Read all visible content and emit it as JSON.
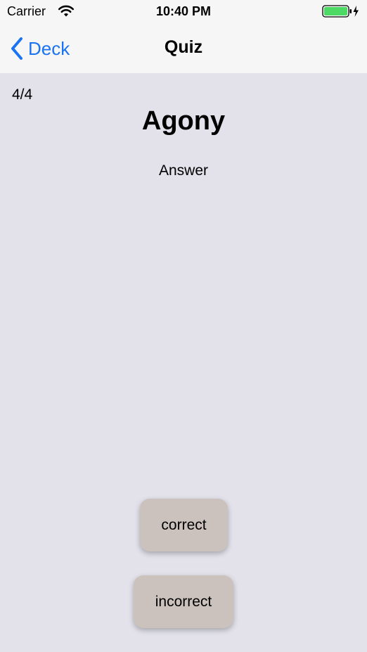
{
  "status_bar": {
    "carrier": "Carrier",
    "time": "10:40 PM",
    "battery_color": "#4cd964",
    "icons": [
      "wifi-icon",
      "battery-icon",
      "charging-bolt-icon"
    ]
  },
  "nav": {
    "back_label": "Deck",
    "title": "Quiz",
    "accent_color": "#1a73f0"
  },
  "quiz": {
    "progress": "4/4",
    "question": "Agony",
    "answer_toggle": "Answer",
    "correct_label": "correct",
    "incorrect_label": "incorrect"
  },
  "colors": {
    "background": "#e3e2eb",
    "bar_background": "#f6f6f6",
    "button_background": "#cbc2bd"
  }
}
